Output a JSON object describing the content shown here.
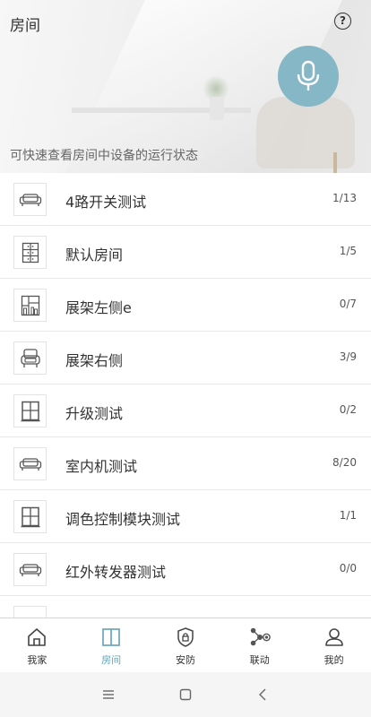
{
  "header": {
    "title": "房间",
    "subtitle": "可快速查看房间中设备的运行状态",
    "help_glyph": "?"
  },
  "rooms": [
    {
      "name": "4路开关测试",
      "count": "1/13",
      "icon": "sofa-icon"
    },
    {
      "name": "默认房间",
      "count": "1/5",
      "icon": "cabinet-icon"
    },
    {
      "name": "展架左侧e",
      "count": "0/7",
      "icon": "bookshelf-icon"
    },
    {
      "name": "展架右侧",
      "count": "3/9",
      "icon": "armchair-icon"
    },
    {
      "name": "升级测试",
      "count": "0/2",
      "icon": "window-icon"
    },
    {
      "name": "室内机测试",
      "count": "8/20",
      "icon": "sofa-icon"
    },
    {
      "name": "调色控制模块测试",
      "count": "1/1",
      "icon": "window-icon"
    },
    {
      "name": "红外转发器测试",
      "count": "0/0",
      "icon": "sofa-icon"
    }
  ],
  "nav": {
    "home": "我家",
    "rooms": "房间",
    "security": "安防",
    "linkage": "联动",
    "mine": "我的"
  },
  "colors": {
    "accent": "#6aa6ba",
    "mic_bg": "#86b7c7"
  }
}
